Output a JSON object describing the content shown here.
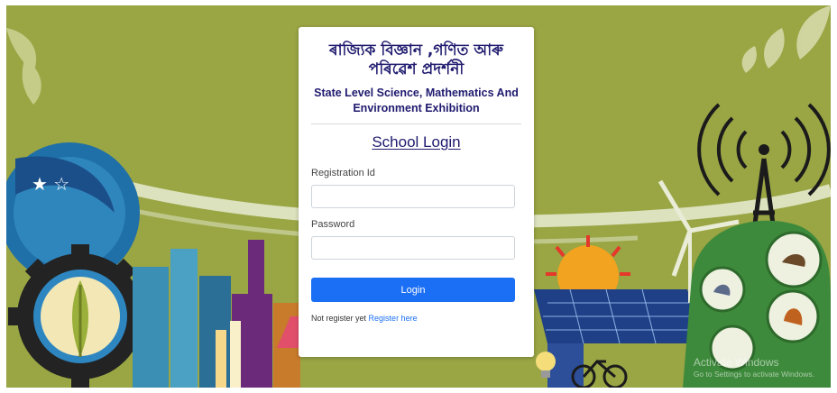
{
  "header": {
    "title_bengali": "ৰাজ্যিক বিজ্ঞান ,গণিত আৰু পৰিৱেশ প্ৰদৰ্শনী",
    "title_english": "State Level Science, Mathematics And Environment Exhibition"
  },
  "login": {
    "heading": "School Login",
    "registration_label": "Registration Id",
    "registration_value": "",
    "password_label": "Password",
    "password_value": "",
    "login_button": "Login",
    "register_prompt": "Not register yet",
    "register_link": "Register here"
  },
  "watermark": {
    "title": "Activate Windows",
    "subtitle": "Go to Settings to activate Windows."
  },
  "colors": {
    "background": "#9aa544",
    "title": "#1f1a6e",
    "button": "#1a6ff5"
  }
}
